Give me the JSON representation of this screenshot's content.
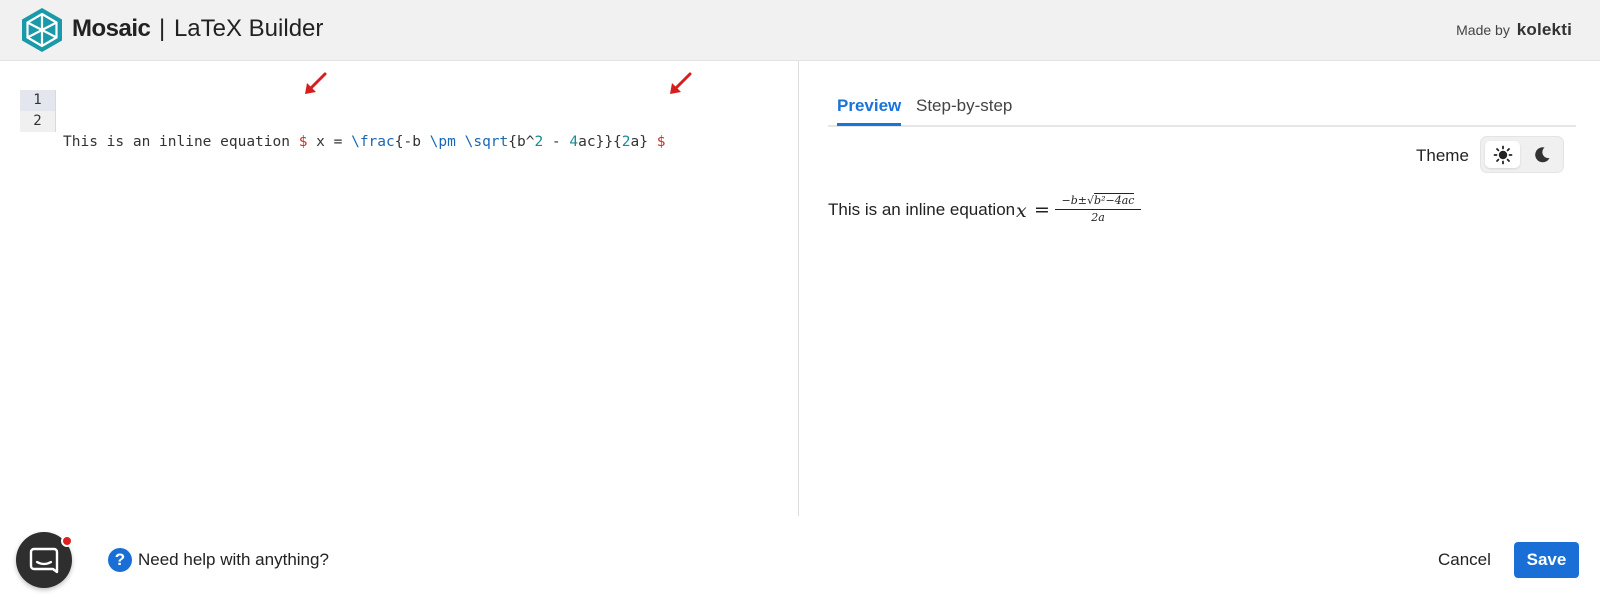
{
  "header": {
    "app_name": "Mosaic",
    "separator": "|",
    "subtitle": "LaTeX Builder",
    "made_by_label": "Made by",
    "company": "kolekti",
    "logo_icon": "hexagon-logo-icon",
    "brand_color": "#1a9aa8"
  },
  "editor": {
    "line_numbers": [
      "1",
      "2"
    ],
    "line1": {
      "t1": "This is an inline equation ",
      "dollar_open": "$",
      "t2": " x = ",
      "cmd_frac": "\\frac",
      "t3": "{-b ",
      "cmd_pm": "\\pm",
      "t4": " ",
      "cmd_sqrt": "\\sqrt",
      "t5": "{b^",
      "n1": "2",
      "t6": " - ",
      "n2": "4",
      "t7": "ac}}{",
      "n3": "2",
      "t8": "a} ",
      "dollar_close": "$"
    },
    "line2": "",
    "annotation_icon": "red-arrow-icon"
  },
  "preview": {
    "tabs": [
      "Preview",
      "Step-by-step"
    ],
    "active_tab": "Preview",
    "theme_label": "Theme",
    "theme_options": [
      "light",
      "dark"
    ],
    "theme_selected": "light",
    "rendered_text": "This is an inline equation",
    "math": {
      "variable": "x",
      "equals": "=",
      "numerator_prefix": "−b±",
      "sqrt_content": "b²−4ac",
      "denominator": "2a"
    }
  },
  "footer": {
    "help_icon_label": "?",
    "help_text": "Need help with anything?",
    "cancel_label": "Cancel",
    "save_label": "Save",
    "chat_icon": "chat-bubble-icon"
  },
  "colors": {
    "accent": "#1a6fd6",
    "tab_active": "#1a73d9",
    "latex_dollar": "#d22c1e",
    "latex_command": "#1b67b3",
    "latex_number": "#1a8b96",
    "notification": "#e02020"
  }
}
